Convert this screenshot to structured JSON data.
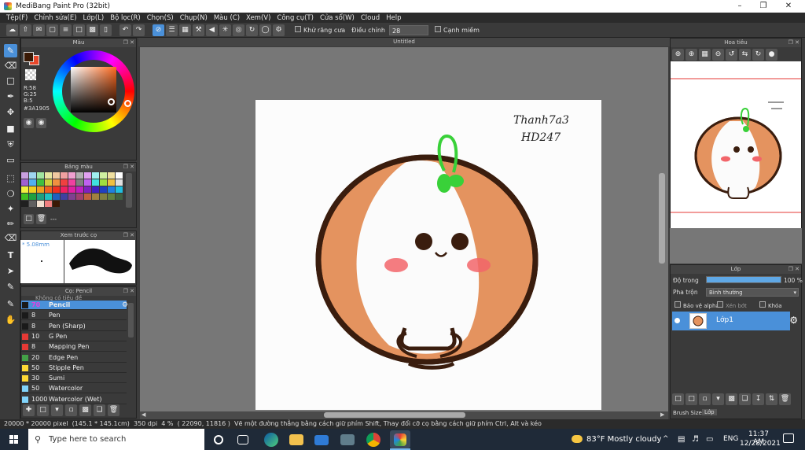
{
  "window": {
    "title": "MediBang Paint Pro (32bit)"
  },
  "menu": [
    "Tệp(F)",
    "Chỉnh sửa(E)",
    "Lớp(L)",
    "Bộ lọc(R)",
    "Chọn(S)",
    "Chụp(N)",
    "Màu (C)",
    "Xem(V)",
    "Công cụ(T)",
    "Cửa sổ(W)",
    "Cloud",
    "Help"
  ],
  "toolbar": {
    "antialias_label": "Khử răng cưa",
    "adjust_label": "Điều chỉnh",
    "adjust_value": "28",
    "edge_label": "Cạnh miềm"
  },
  "color_panel": {
    "title": "Màu",
    "r": "R:58",
    "g": "G:25",
    "b": "B:5",
    "hex": "#3A1905",
    "primary": "#3a1905",
    "secondary": "#e8472a"
  },
  "palette_panel": {
    "title": "Bảng màu",
    "more": "---",
    "colors": [
      "#c8a0e0",
      "#9fd6f0",
      "#a0e6a0",
      "#e6e6a0",
      "#f0c8a0",
      "#f0a0a0",
      "#f0a0d0",
      "#b0b0b0",
      "#e0a0f0",
      "#a0f0f0",
      "#d0f0a0",
      "#f0e0a0",
      "#ffffff",
      "#a060d0",
      "#50b0f0",
      "#40c040",
      "#d0d040",
      "#f09040",
      "#f04040",
      "#f040a0",
      "#808080",
      "#c060f0",
      "#40e0e0",
      "#a0e040",
      "#f0c040",
      "#e0e0e0",
      "#f0f040",
      "#f0d020",
      "#f0a020",
      "#f06020",
      "#f03020",
      "#f02060",
      "#e020a0",
      "#c020c0",
      "#8020c0",
      "#4020c0",
      "#2040c0",
      "#2080e0",
      "#20c0e0",
      "#40c020",
      "#20a040",
      "#20a080",
      "#20c0c0",
      "#2060c0",
      "#4040a0",
      "#804090",
      "#a04070",
      "#c06040",
      "#a08040",
      "#808040",
      "#608040",
      "#406040",
      "#202020",
      "#606060",
      "#f0e0d0",
      "#f08080",
      "#3a1905"
    ]
  },
  "preview_panel": {
    "title": "Xem trước cọ",
    "size": "5.08mm"
  },
  "brush_panel": {
    "title": "Cọ: Pencil",
    "header": "Không có tiêu đề",
    "items": [
      {
        "size": "70",
        "name": "Pencil",
        "color": "#1a1a1a",
        "selected": true
      },
      {
        "size": "8",
        "name": "Pen",
        "color": "#1a1a1a"
      },
      {
        "size": "8",
        "name": "Pen (Sharp)",
        "color": "#1a1a1a"
      },
      {
        "size": "10",
        "name": "G Pen",
        "color": "#e53935"
      },
      {
        "size": "8",
        "name": "Mapping Pen",
        "color": "#e53935"
      },
      {
        "size": "20",
        "name": "Edge Pen",
        "color": "#43a047"
      },
      {
        "size": "50",
        "name": "Stipple Pen",
        "color": "#fdd835"
      },
      {
        "size": "30",
        "name": "Sumi",
        "color": "#fdd835"
      },
      {
        "size": "50",
        "name": "Watercolor",
        "color": "#81d4fa"
      },
      {
        "size": "1000",
        "name": "Watercolor (Wet)",
        "color": "#81d4fa"
      }
    ]
  },
  "canvas": {
    "title": "Untitled",
    "signature_line1": "Thanh7a3",
    "signature_line2": "HD247"
  },
  "navigator": {
    "title": "Hoa tiêu"
  },
  "layer_panel": {
    "title": "Lớp",
    "opacity_label": "Độ trong",
    "opacity_value": "100 %",
    "opacity": 1.0,
    "blend_label": "Pha trộn",
    "blend_value": "Bình thường",
    "protect_alpha": "Bảo vệ alpha",
    "clipping": "Xén bớt",
    "lock": "Khóa",
    "layers": [
      {
        "name": "Lớp1"
      }
    ],
    "tabs": [
      "Brush Size",
      "Lớp"
    ]
  },
  "status": {
    "size": "20000 * 20000 pixel",
    "physical": "(145.1 * 145.1cm)",
    "dpi": "350 dpi",
    "zoom": "4 %",
    "coords": "( 22090, 11816 )",
    "hint": "Vẽ một đường thẳng bằng cách giữ phím Shift, Thay đổi cỡ cọ bằng cách giữ phím Ctrl, Alt và kéo"
  },
  "taskbar": {
    "search_placeholder": "Type here to search",
    "weather": "83°F  Mostly cloudy",
    "lang": "ENG",
    "time": "11:37 AM",
    "date": "12/28/2021"
  }
}
